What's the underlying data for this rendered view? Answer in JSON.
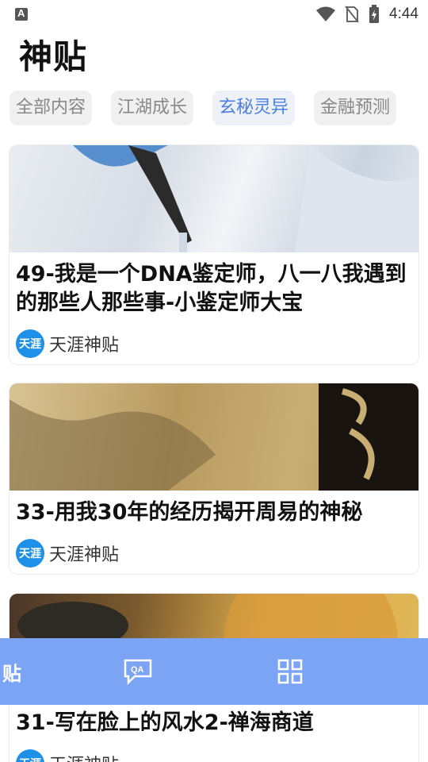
{
  "status_bar": {
    "time": "4:44",
    "icons": [
      "app-notification-icon",
      "wifi-icon",
      "no-sim-icon",
      "battery-charging-icon"
    ]
  },
  "header": {
    "title": "神贴"
  },
  "tabs": [
    {
      "label": "全部内容",
      "active": false
    },
    {
      "label": "江湖成长",
      "active": false
    },
    {
      "label": "玄秘灵异",
      "active": true
    },
    {
      "label": "金融预测",
      "active": false
    }
  ],
  "posts": [
    {
      "title": "49-我是一个DNA鉴定师，八一八我遇到的那些人那些事-小鉴定师大宝",
      "source": "天涯神贴",
      "logo_text": "天涯"
    },
    {
      "title": "33-用我30年的经历揭开周易的神秘",
      "source": "天涯神贴",
      "logo_text": "天涯"
    },
    {
      "title": "31-写在脸上的风水2-禅海商道",
      "source": "天涯神贴",
      "logo_text": "天涯"
    }
  ],
  "bottom_nav": {
    "home_label_partial": "贴",
    "items": [
      "home-tab",
      "qa-tab",
      "grid-tab"
    ]
  },
  "colors": {
    "accent": "#4a7fe0",
    "nav_bg": "#7ba4f4",
    "source_logo": "#1e90e8"
  }
}
